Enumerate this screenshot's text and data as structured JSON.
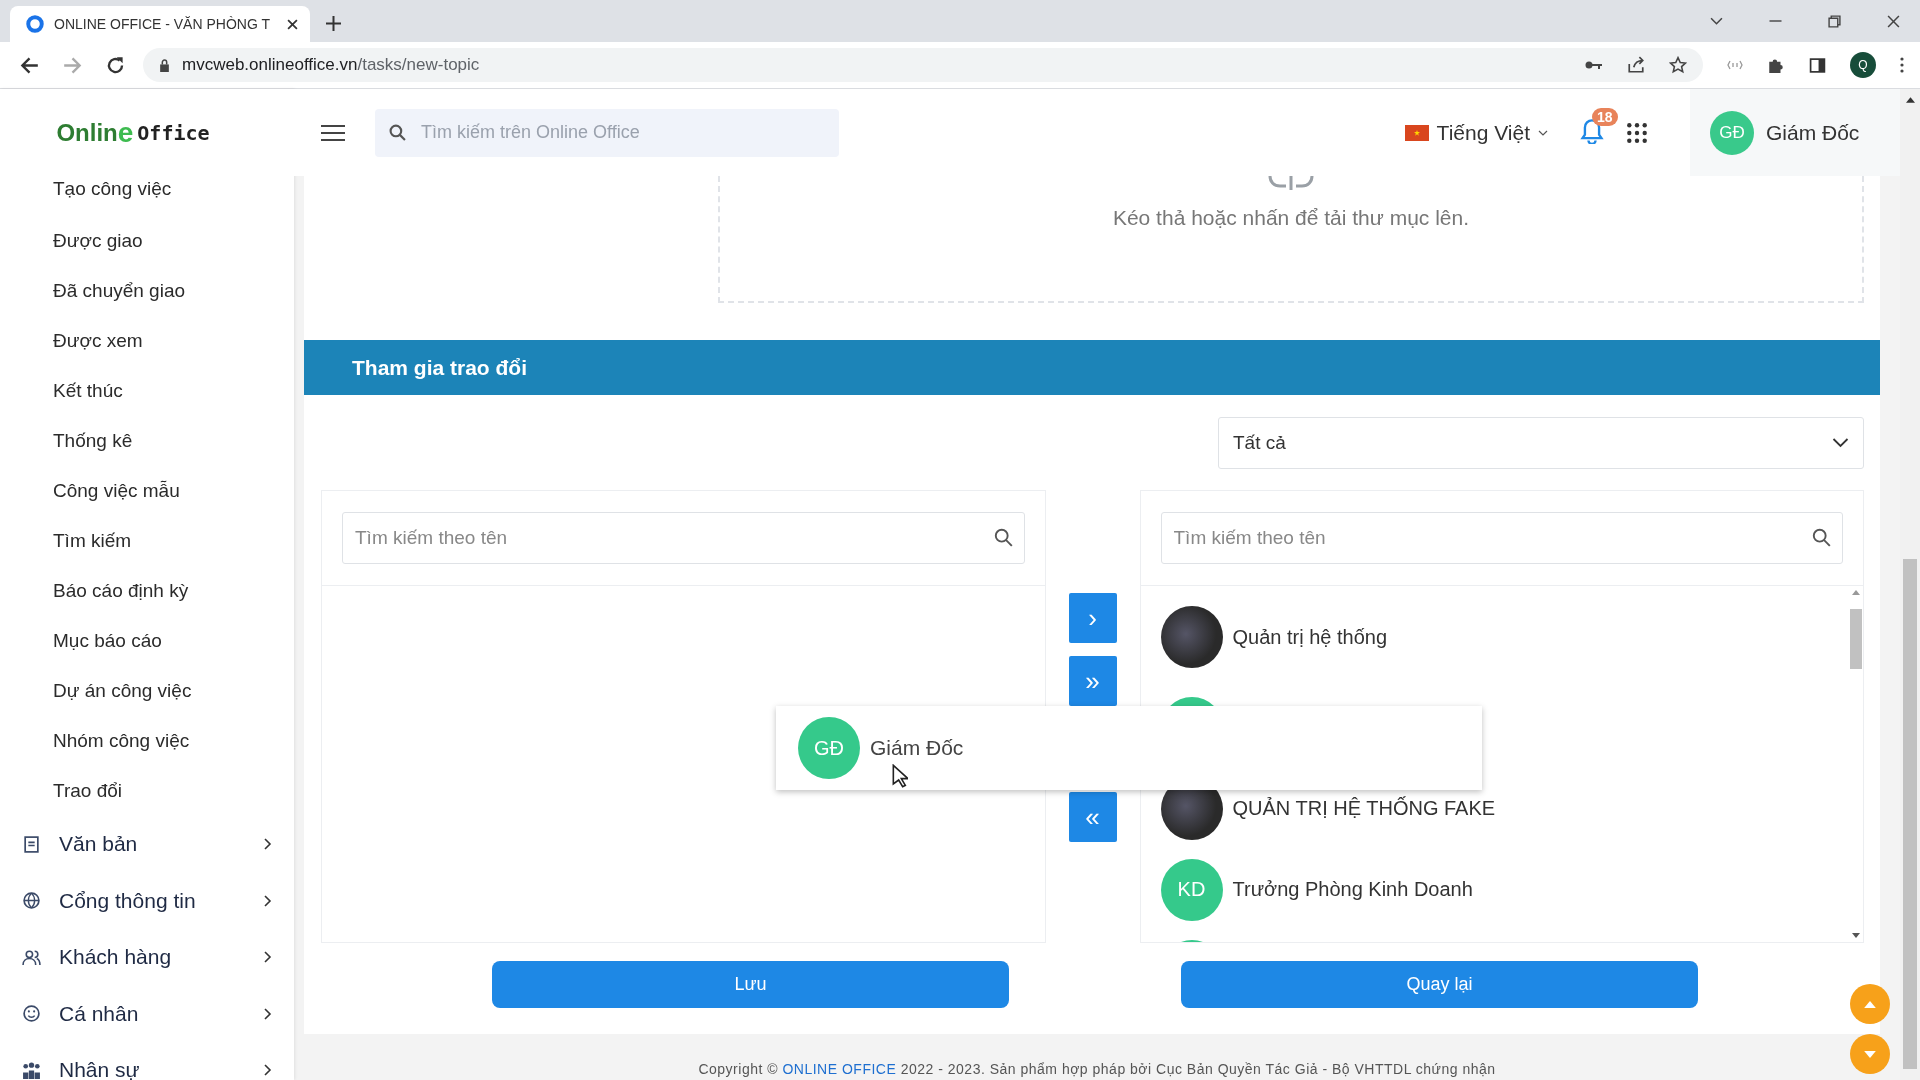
{
  "browser": {
    "tab_title": "ONLINE OFFICE - VĂN PHÒNG T",
    "url_host": "mvcweb.onlineoffice.vn",
    "url_path": "/tasks/new-topic",
    "profile_initial": "Q"
  },
  "logo": {
    "part_1": "Onlin",
    "part_2": "e",
    "part_3": "Office"
  },
  "sidebar": {
    "items": [
      {
        "label": "Tạo công việc"
      },
      {
        "label": "Được giao"
      },
      {
        "label": "Đã chuyển giao"
      },
      {
        "label": "Được xem"
      },
      {
        "label": "Kết thúc"
      },
      {
        "label": "Thống kê"
      },
      {
        "label": "Công việc mẫu"
      },
      {
        "label": "Tìm kiếm"
      },
      {
        "label": "Báo cáo định kỳ"
      },
      {
        "label": "Mục báo cáo"
      },
      {
        "label": "Dự án công việc"
      },
      {
        "label": "Nhóm công việc"
      },
      {
        "label": "Trao đổi"
      }
    ],
    "groups": [
      {
        "kind": "document",
        "label": "Văn bản"
      },
      {
        "kind": "globe",
        "label": "Cổng thông tin"
      },
      {
        "kind": "people",
        "label": "Khách hàng"
      },
      {
        "kind": "smile",
        "label": "Cá nhân"
      },
      {
        "kind": "team",
        "label": "Nhân sự"
      }
    ]
  },
  "header": {
    "search_placeholder": "Tìm kiếm trên Online Office",
    "language": "Tiếng Việt",
    "notification_count": "18",
    "user": {
      "initials": "GĐ",
      "name": "Giám Đốc"
    }
  },
  "upload": {
    "hint": "Kéo thả hoặc nhấn để tải thư mục lên."
  },
  "section": {
    "title": "Tham gia trao đổi",
    "filter": "Tất cả",
    "left_panel": {
      "search_placeholder": "Tìm kiếm theo tên"
    },
    "transfer_buttons": [
      "›",
      "»",
      "«"
    ],
    "right_panel": {
      "search_placeholder": "Tìm kiếm theo tên",
      "members": [
        {
          "kind": "photo",
          "name": "Quản trị hệ thống"
        },
        {
          "kind": "initials"
        },
        {
          "kind": "photo",
          "name": "QUẢN TRỊ HỆ THỐNG FAKE"
        },
        {
          "kind": "initials",
          "initials": "KD",
          "name": "Trưởng Phòng Kinh Doanh"
        },
        {
          "kind": "initials"
        }
      ]
    },
    "drag_item": {
      "initials": "GĐ",
      "name": "Giám Đốc"
    },
    "buttons": [
      "Lưu",
      "Quay lại"
    ]
  },
  "footer": {
    "prefix": "Copyright © ",
    "link": "ONLINE OFFICE",
    "suffix": " 2022 - 2023. Sản phẩm hợp pháp bởi Cục Bản Quyền Tác Giả - Bộ VHTTDL chứng nhận"
  }
}
